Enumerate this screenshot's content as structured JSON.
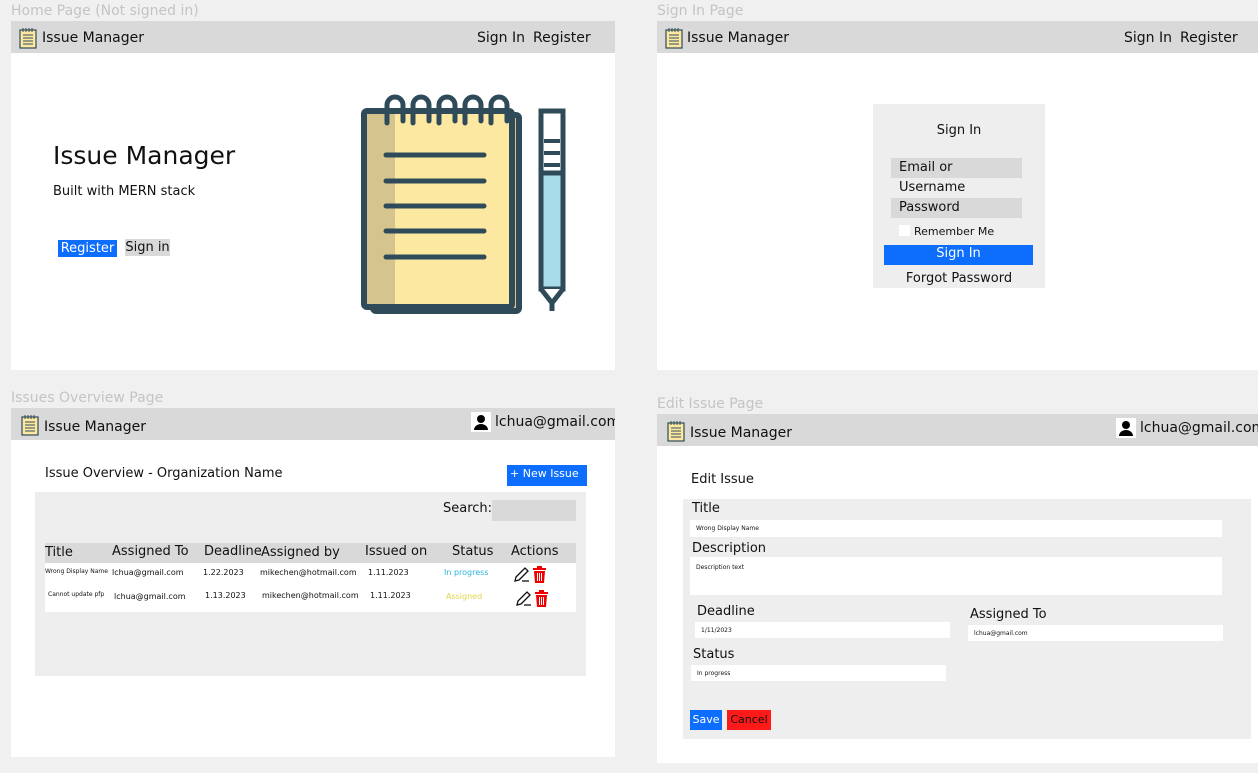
{
  "app_name": "Issue Manager",
  "frames": {
    "home": {
      "label": "Home Page (Not signed in)",
      "nav": {
        "sign_in": "Sign In",
        "register": "Register"
      },
      "hero_title": "Issue Manager",
      "hero_subtitle": "Built with MERN stack",
      "register_button": "Register",
      "sign_in_button": "Sign in"
    },
    "signin": {
      "label": "Sign In Page",
      "nav": {
        "sign_in": "Sign In",
        "register": "Register"
      },
      "form_title": "Sign In",
      "email_placeholder": "Email or Username",
      "password_placeholder": "Password",
      "remember_me": "Remember Me",
      "submit": "Sign In",
      "forgot": "Forgot Password"
    },
    "overview": {
      "label": "Issues Overview Page",
      "user": "lchua@gmail.com",
      "heading": "Issue Overview - Organization Name",
      "new_issue": "+ New Issue",
      "search_label": "Search:",
      "columns": [
        "Title",
        "Assigned To",
        "Deadline",
        "Assigned by",
        "Issued on",
        "Status",
        "Actions"
      ],
      "rows": [
        {
          "title": "Wrong Display Name",
          "assigned_to": "lchua@gmail.com",
          "deadline": "1.22.2023",
          "assigned_by": "mikechen@hotmail.com",
          "issued_on": "1.11.2023",
          "status": "In progress",
          "status_color": "#29b6e0"
        },
        {
          "title": "Cannot update pfp",
          "assigned_to": "lchua@gmail.com",
          "deadline": "1.13.2023",
          "assigned_by": "mikechen@hotmail.com",
          "issued_on": "1.11.2023",
          "status": "Assigned",
          "status_color": "#e3d54a"
        }
      ]
    },
    "edit": {
      "label": "Edit Issue Page",
      "user": "lchua@gmail.com",
      "heading": "Edit Issue",
      "title_label": "Title",
      "title_value": "Wrong Display Name",
      "description_label": "Description",
      "description_value": "Description text",
      "deadline_label": "Deadline",
      "deadline_value": "1/11/2023",
      "assigned_to_label": "Assigned To",
      "assigned_to_value": "lchua@gmail.com",
      "status_label": "Status",
      "status_value": "In progress",
      "save": "Save",
      "cancel": "Cancel"
    }
  },
  "colors": {
    "accent": "#0d6efd",
    "navbar": "#d9d9d9",
    "danger": "#ff1a1a",
    "panel": "#eeeeee"
  },
  "icons": [
    "notepad-icon",
    "user-icon",
    "edit-icon",
    "trash-icon"
  ]
}
